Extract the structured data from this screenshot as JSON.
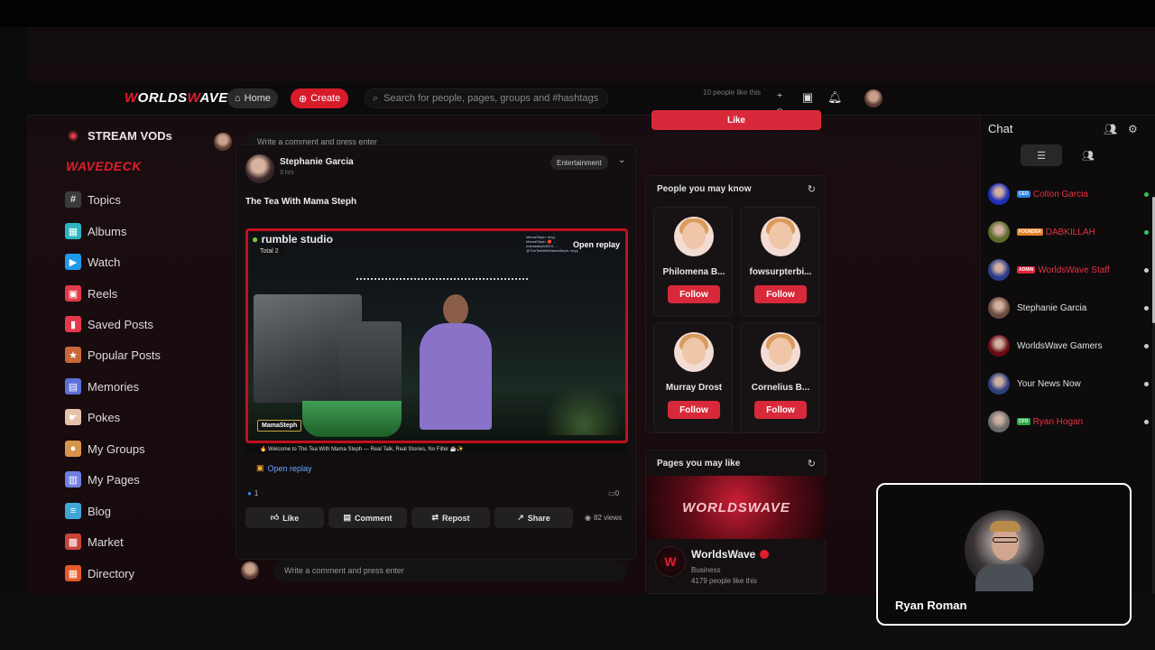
{
  "colors": {
    "accent": "#d8293a",
    "brand_red": "#e11d2e",
    "bg": "#130d0f",
    "online": "#37c35a"
  },
  "header": {
    "logo_prefix": "W",
    "logo_mid": "ORLDS",
    "logo_w2": "W",
    "logo_suffix": "AVE",
    "home_label": "Home",
    "create_label": "Create",
    "search_placeholder": "Search for people, pages, groups and #hashtags"
  },
  "sidebar": {
    "stream_label": "STREAM VODs",
    "wavedeck_w": "W",
    "wavedeck_rest": "AVEDECK",
    "items": [
      {
        "label": "Topics",
        "icon": "hash-icon",
        "color": "#3b3b3b"
      },
      {
        "label": "Albums",
        "icon": "albums-icon",
        "color": "#2bb3c0"
      },
      {
        "label": "Watch",
        "icon": "watch-icon",
        "color": "#1e9be8"
      },
      {
        "label": "Reels",
        "icon": "reels-icon",
        "color": "#e5394b"
      },
      {
        "label": "Saved Posts",
        "icon": "bookmark-icon",
        "color": "#e5394b"
      },
      {
        "label": "Popular Posts",
        "icon": "popular-icon",
        "color": "#c9683a"
      },
      {
        "label": "Memories",
        "icon": "memories-icon",
        "color": "#5a6fd8"
      },
      {
        "label": "Pokes",
        "icon": "poke-icon",
        "color": "#e8c2a8"
      },
      {
        "label": "My Groups",
        "icon": "groups-icon",
        "color": "#d8944a"
      },
      {
        "label": "My Pages",
        "icon": "pages-icon",
        "color": "#6f7ee0"
      },
      {
        "label": "Blog",
        "icon": "blog-icon",
        "color": "#3fa7d6"
      },
      {
        "label": "Market",
        "icon": "market-icon",
        "color": "#c9433a"
      },
      {
        "label": "Directory",
        "icon": "directory-icon",
        "color": "#e45a2a"
      }
    ]
  },
  "feed": {
    "comment_placeholder": "Write a comment and press enter",
    "post": {
      "author": "Stephanie Garcia",
      "time": "3 hrs",
      "category": "Entertainment",
      "title": "The Tea With Mama Steph",
      "video": {
        "brand": "rumble studio",
        "total": "Total 2",
        "open_replay_overlay": "Open replay",
        "tag": "MamaSteph",
        "chat_lines": [
          "MamaSteph: heyy",
          "MamaSteph: 🔴 ...",
          "mamasteph4004: ...",
          "@TheTeaWithMamaSteph: heyy"
        ],
        "strip": "🔥 Welcome to The Tea With Mama Steph — Real Talk, Real Stories, No Filter ☕✨"
      },
      "open_replay": "Open replay",
      "reaction_count": "1",
      "comment_count": "0",
      "actions": {
        "like": "Like",
        "comment": "Comment",
        "repost": "Repost",
        "share": "Share"
      },
      "views": "82 views"
    }
  },
  "right": {
    "like_text": "10 people like this",
    "like_label": "Like",
    "people_title": "People you may know",
    "people": [
      {
        "name": "Philomena B...",
        "follow": "Follow"
      },
      {
        "name": "fowsurpterbi...",
        "follow": "Follow"
      },
      {
        "name": "Murray Drost",
        "follow": "Follow"
      },
      {
        "name": "Cornelius B...",
        "follow": "Follow"
      }
    ],
    "pages_title": "Pages you may like",
    "page": {
      "banner": "WORLDSWAVE",
      "name": "WorldsWave",
      "category": "Business",
      "likes": "4179 people like this"
    }
  },
  "chat": {
    "title": "Chat",
    "items": [
      {
        "name": "Colton Garcia",
        "badge": "CEO",
        "badge_color": "#2a7fe0",
        "name_color": "#e8323f",
        "online": true,
        "av": "#1e2fb8"
      },
      {
        "name": "DABKILLAH",
        "badge": "FOUNDER",
        "badge_color": "#e2822a",
        "name_color": "#e8323f",
        "online": true,
        "av": "#5a6b2a"
      },
      {
        "name": "WorldsWave Staff",
        "badge": "ADMIN",
        "badge_color": "#e0243a",
        "name_color": "#e8323f",
        "online": false,
        "av": "#2b3c8a"
      },
      {
        "name": "Stephanie Garcia",
        "badge": "",
        "badge_color": "",
        "name_color": "#e2e2e2",
        "online": false,
        "av": "#6b4a3f"
      },
      {
        "name": "WorldsWave Gamers",
        "badge": "",
        "badge_color": "",
        "name_color": "#e2e2e2",
        "online": false,
        "av": "#6a0c15"
      },
      {
        "name": "Your News Now",
        "badge": "",
        "badge_color": "",
        "name_color": "#e2e2e2",
        "online": false,
        "av": "#2c3f7a"
      },
      {
        "name": "Ryan Hogan",
        "badge": "CFO",
        "badge_color": "#2aa84a",
        "name_color": "#e8323f",
        "online": false,
        "av": "#6a6a6a"
      }
    ]
  },
  "webcam": {
    "name": "Ryan Roman"
  }
}
